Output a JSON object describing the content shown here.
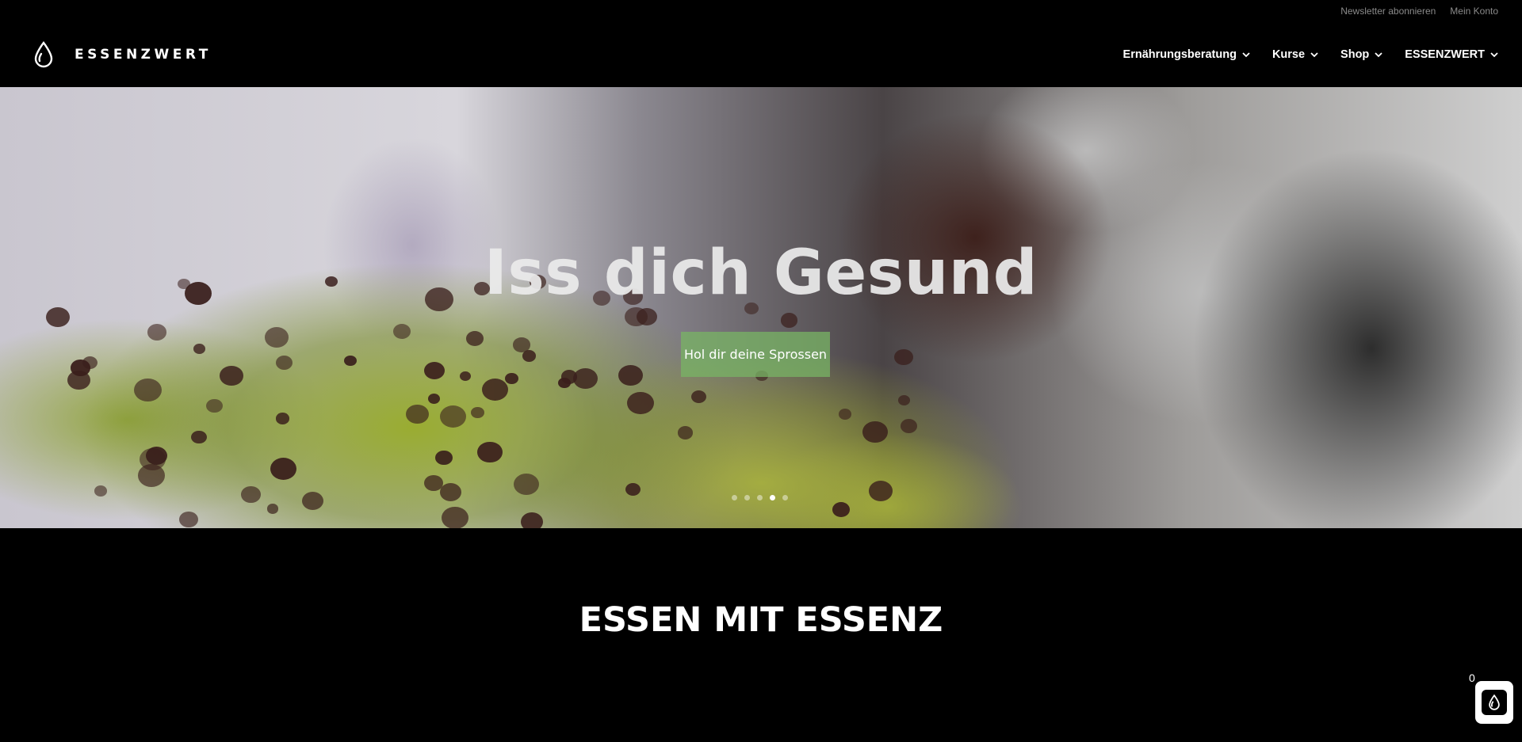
{
  "topbar": {
    "newsletter": "Newsletter abonnieren",
    "account": "Mein Konto"
  },
  "header": {
    "logo_text": "ESSENZWERT",
    "nav": [
      {
        "label": "Ernährungsberatung"
      },
      {
        "label": "Kurse"
      },
      {
        "label": "Shop"
      },
      {
        "label": "ESSENZWERT"
      }
    ]
  },
  "hero": {
    "title": "Iss dich Gesund",
    "button_label": "Hol dir deine Sprossen",
    "slides_total": 5,
    "active_slide": 4
  },
  "section": {
    "title": "ESSEN MIT ESSENZ"
  },
  "cart": {
    "count": "0"
  },
  "colors": {
    "background": "#000000",
    "button_green": "#78b464",
    "topbar_text": "#8a8a8a"
  }
}
